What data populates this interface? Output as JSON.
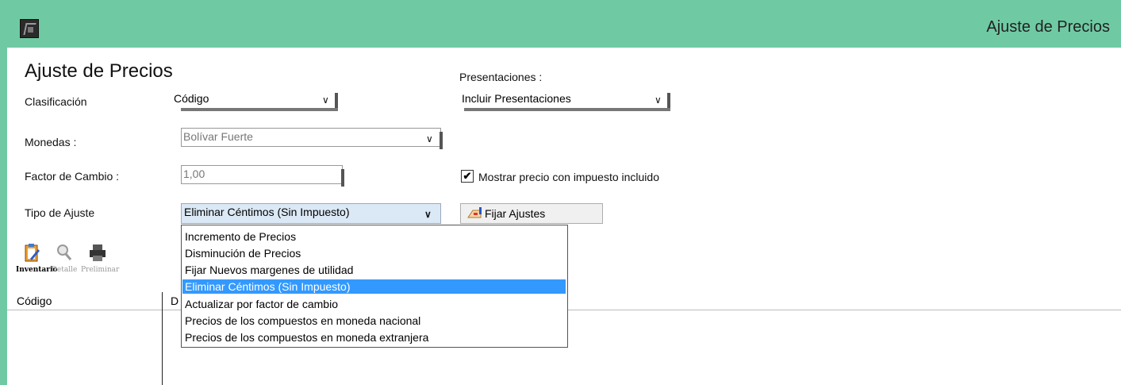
{
  "window": {
    "title": "Ajuste de Precios",
    "app_icon": "app-logo-icon"
  },
  "form": {
    "heading": "Ajuste de Precios",
    "clasificacion": {
      "label": "Clasificación",
      "value": "Código"
    },
    "presentaciones": {
      "label": "Presentaciones :",
      "value": "Incluir Presentaciones"
    },
    "monedas": {
      "label": "Monedas  :",
      "value": "Bolívar Fuerte"
    },
    "factor": {
      "label": "Factor de Cambio :",
      "value": "1,00"
    },
    "mostrar_precio": {
      "label": "Mostrar  precio con impuesto incluido",
      "checked": true
    },
    "tipo_ajuste": {
      "label": "Tipo de Ajuste",
      "value": "Eliminar Céntimos (Sin Impuesto)"
    },
    "fijar_button": "Fijar Ajustes"
  },
  "toolbar": [
    {
      "label": "Inventario",
      "icon": "clipboard-edit-icon",
      "enabled": true
    },
    {
      "label": "Detalle",
      "icon": "magnifier-icon",
      "enabled": false
    },
    {
      "label": "Preliminar",
      "icon": "printer-icon",
      "enabled": false
    }
  ],
  "grid": {
    "columns": [
      "Código",
      "D"
    ]
  },
  "dropdown": {
    "options": [
      "Incremento de Precios",
      "Disminución de Precios",
      "Fijar Nuevos margenes de utilidad",
      "Eliminar Céntimos (Sin Impuesto)",
      "Actualizar por factor de cambio",
      "Precios de los compuestos en moneda nacional",
      "Precios de los compuestos en moneda extranjera"
    ],
    "selected_index": 3
  },
  "colors": {
    "titlebar": "#6fcaa3",
    "selection": "#3399ff"
  }
}
